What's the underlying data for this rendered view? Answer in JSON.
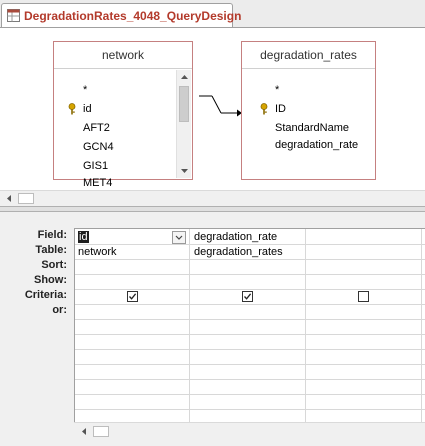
{
  "tab": {
    "title": "DegradationRates_4048_QueryDesign",
    "icon": "query-icon"
  },
  "tables": [
    {
      "name": "network",
      "fields": [
        "*",
        "id",
        "AFT2",
        "GCN4",
        "GIS1",
        "MET4"
      ],
      "key_field": "id"
    },
    {
      "name": "degradation_rates",
      "fields": [
        "*",
        "ID",
        "StandardName",
        "degradation_rate"
      ],
      "key_field": "ID"
    }
  ],
  "grid": {
    "row_labels": [
      "Field:",
      "Table:",
      "Sort:",
      "Show:",
      "Criteria:",
      "or:"
    ],
    "columns": [
      {
        "field": "id",
        "table": "network",
        "show": true
      },
      {
        "field": "degradation_rate",
        "table": "degradation_rates",
        "show": true
      },
      {
        "field": "",
        "table": "",
        "show": false
      }
    ]
  },
  "colors": {
    "tab_title": "#b33a2b",
    "table_border": "#c58080",
    "key_icon": "#d6a400"
  }
}
